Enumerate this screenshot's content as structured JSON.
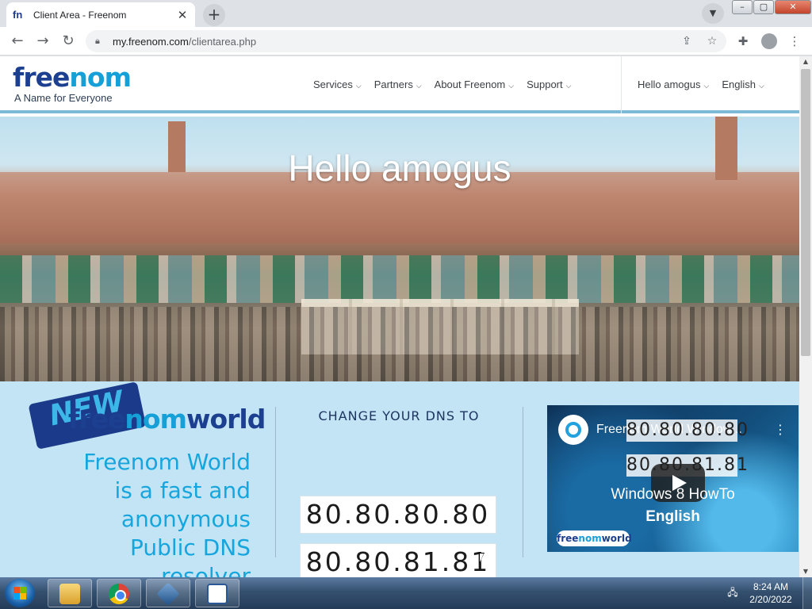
{
  "browser": {
    "tab": {
      "favicon": "fn",
      "title": "Client Area - Freenom",
      "close_icon": "close-icon"
    },
    "newtab_icon": "plus-icon",
    "tablist_icon": "chevron-down-icon",
    "url_host": "my.freenom.com",
    "url_path": "/clientarea.php",
    "icons": [
      "back-icon",
      "forward-icon",
      "reload-icon",
      "lock-icon",
      "share-icon",
      "star-icon",
      "extensions-icon",
      "profile-icon",
      "menu-icon"
    ]
  },
  "site": {
    "logo_free": "free",
    "logo_nom": "nom",
    "tagline": "A Name for Everyone",
    "nav": [
      {
        "label": "Services"
      },
      {
        "label": "Partners"
      },
      {
        "label": "About Freenom"
      },
      {
        "label": "Support"
      }
    ],
    "user_nav": [
      {
        "label": "Hello amogus"
      },
      {
        "label": "English"
      }
    ],
    "hero_title": "Hello amogus",
    "colors": {
      "brand_dark": "#1d3f8f",
      "brand_light": "#16a0d8",
      "promo_bg": "#c3e4f4",
      "promo_text": "#16a6dd"
    }
  },
  "promo": {
    "badge": "NEW",
    "fw_free": "free",
    "fw_nom": "nom",
    "fw_world": "world",
    "description": [
      "Freenom World",
      "is a fast and",
      "anonymous",
      "Public DNS",
      "resolver"
    ],
    "dns_heading": "CHANGE YOUR DNS TO",
    "dns_primary": "80.80.80.80",
    "dns_secondary": "80.80.81.81"
  },
  "video": {
    "title": "Freenom World Window...",
    "ip1": "80.80.80.80",
    "ip2": "80.80.81.81",
    "subtitle1": "Windows 8 HowTo",
    "subtitle2": "English",
    "brand_free": "free",
    "brand_nom": "nom",
    "brand_world": "world"
  },
  "taskbar": {
    "apps": [
      "Windows Explorer",
      "Google Chrome",
      "VirtualBox",
      "Window"
    ],
    "time": "8:24 AM",
    "date": "2/20/2022"
  }
}
